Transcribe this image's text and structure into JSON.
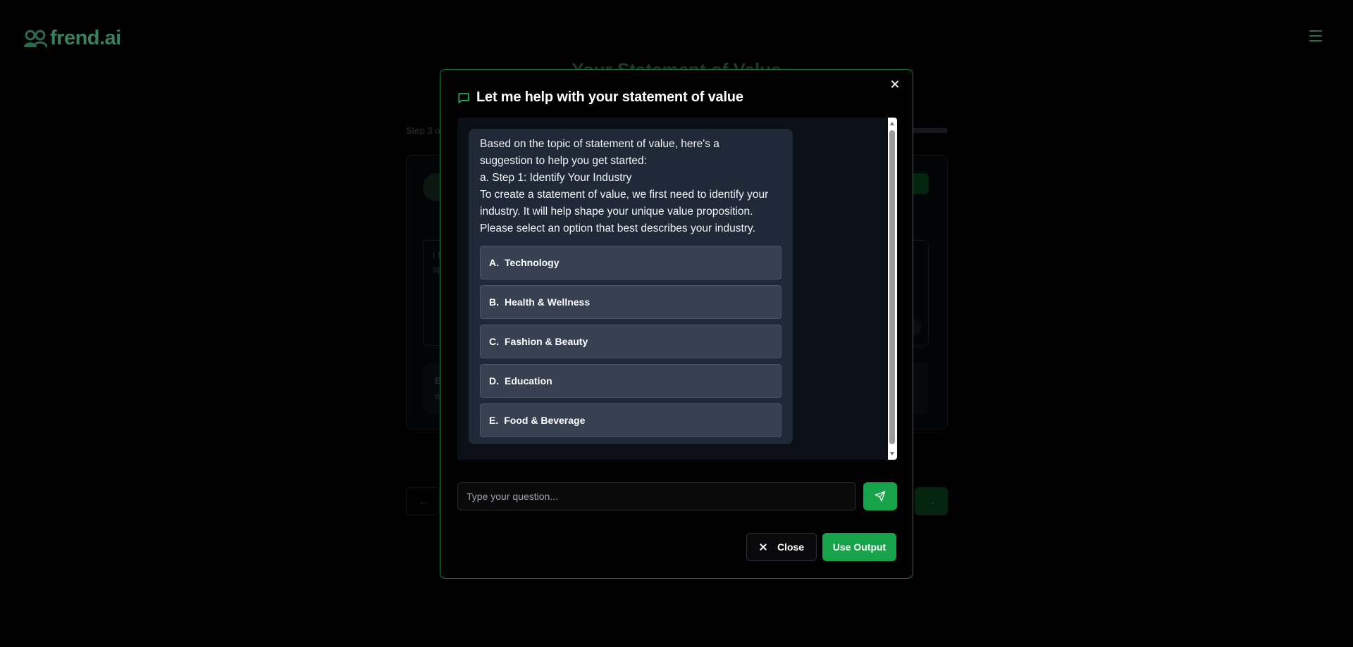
{
  "app": {
    "logo_text": "frend.ai",
    "page_title": "Your Statement of Value",
    "step_text": "Step 3 o",
    "textarea_preview": "I f",
    "textarea_preview2": "sp",
    "info_box_title": "E",
    "info_box_text": "w"
  },
  "modal": {
    "title": "Let me help with your statement of value",
    "message_lines": [
      "Based on the topic of statement of value, here's a",
      "suggestion to help you get started:",
      "a. Step 1: Identify Your Industry",
      "To create a statement of value, we first need to identify your",
      "industry. It will help shape your unique value proposition.",
      "Please select an option that best describes your industry."
    ],
    "options": [
      {
        "letter": "A.",
        "label": "Technology"
      },
      {
        "letter": "B.",
        "label": "Health & Wellness"
      },
      {
        "letter": "C.",
        "label": "Fashion & Beauty"
      },
      {
        "letter": "D.",
        "label": "Education"
      },
      {
        "letter": "E.",
        "label": "Food & Beverage"
      }
    ],
    "input_placeholder": "Type your question...",
    "close_label": "Close",
    "use_output_label": "Use Output"
  },
  "colors": {
    "accent": "#16a34a",
    "modal_border": "#15803d",
    "bubble": "#1f2937",
    "option_bg": "#374151"
  },
  "icons": {
    "header_icon": "message-square-icon",
    "send_icon": "send-icon",
    "menu_icon": "hamburger-menu-icon"
  }
}
